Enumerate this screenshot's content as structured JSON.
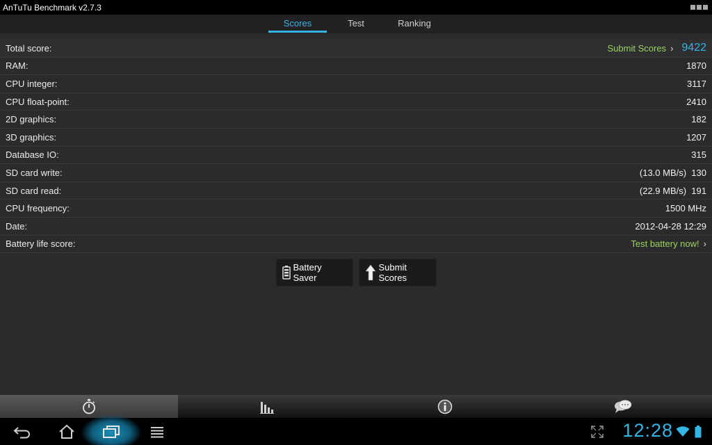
{
  "app": {
    "title": "AnTuTu Benchmark v2.7.3"
  },
  "tabs": [
    {
      "label": "Scores",
      "active": true
    },
    {
      "label": "Test",
      "active": false
    },
    {
      "label": "Ranking",
      "active": false
    }
  ],
  "total": {
    "label": "Total score:",
    "submit_link": "Submit Scores",
    "value": "9422"
  },
  "scores": [
    {
      "label": "RAM:",
      "value": "1870"
    },
    {
      "label": "CPU integer:",
      "value": "3117"
    },
    {
      "label": "CPU float-point:",
      "value": "2410"
    },
    {
      "label": "2D graphics:",
      "value": "182"
    },
    {
      "label": "3D graphics:",
      "value": "1207"
    },
    {
      "label": "Database IO:",
      "value": "315"
    },
    {
      "label": "SD card write:",
      "value": "(13.0 MB/s)  130"
    },
    {
      "label": "SD card read:",
      "value": "(22.9 MB/s)  191"
    },
    {
      "label": "CPU frequency:",
      "value": "1500 MHz"
    },
    {
      "label": "Date:",
      "value": "2012-04-28 12:29"
    }
  ],
  "battery": {
    "label": "Battery life score:",
    "link": "Test battery now!"
  },
  "buttons": {
    "battery_saver": "Battery Saver",
    "submit_scores": "Submit Scores"
  },
  "bottom_nav": [
    {
      "icon": "stopwatch-icon",
      "active": true
    },
    {
      "icon": "bar-chart-icon",
      "active": false
    },
    {
      "icon": "info-icon",
      "active": false
    },
    {
      "icon": "chat-bubbles-icon",
      "active": false
    }
  ],
  "system": {
    "clock": "12:28"
  },
  "colors": {
    "accent": "#33b5e5",
    "link": "#9bd35a",
    "background": "#2b2b2d"
  }
}
